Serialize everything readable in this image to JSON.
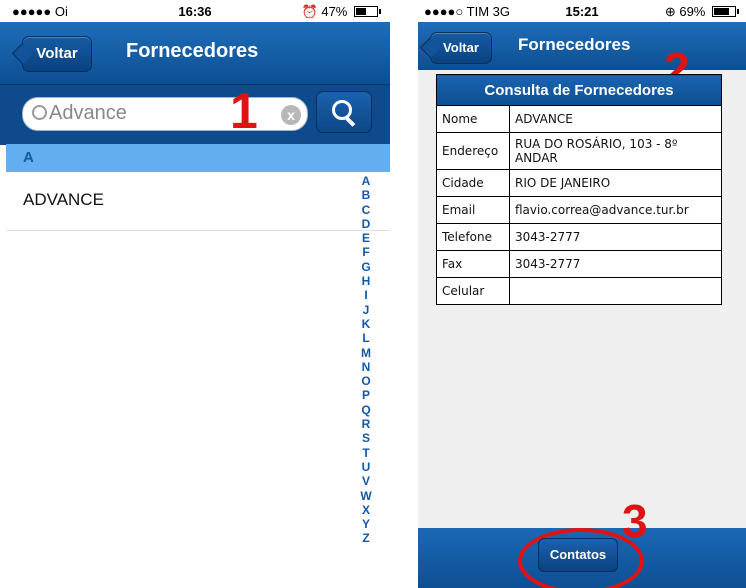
{
  "left_screen": {
    "status": {
      "carrier": "●●●●● Oi ",
      "wifi_icon": "wifi-icon",
      "time": "16:36",
      "battery_text": "47%",
      "battery_level": 0.47
    },
    "nav": {
      "back_label": "Voltar",
      "title": "Fornecedores"
    },
    "search": {
      "value": "Advance",
      "clear_glyph": "x"
    },
    "section_header": "A",
    "list": [
      {
        "label": "ADVANCE"
      }
    ],
    "index_letters": [
      "A",
      "B",
      "C",
      "D",
      "E",
      "F",
      "G",
      "H",
      "I",
      "J",
      "K",
      "L",
      "M",
      "N",
      "O",
      "P",
      "Q",
      "R",
      "S",
      "T",
      "U",
      "V",
      "W",
      "X",
      "Y",
      "Z"
    ],
    "annotation": "1"
  },
  "right_screen": {
    "status": {
      "carrier": "●●●●○ TIM  3G",
      "time": "15:21",
      "battery_text": "69%",
      "battery_level": 0.69
    },
    "nav": {
      "back_label": "Voltar",
      "title": "Fornecedores"
    },
    "annotation": "2",
    "table": {
      "title": "Consulta de Fornecedores",
      "rows": [
        {
          "key": "Nome",
          "value": "ADVANCE"
        },
        {
          "key": "Endereço",
          "value": "RUA DO ROSÁRIO, 103 - 8º ANDAR"
        },
        {
          "key": "Cidade",
          "value": "RIO DE JANEIRO"
        },
        {
          "key": "Email",
          "value": "flavio.correa@advance.tur.br"
        },
        {
          "key": "Telefone",
          "value": "3043-2777"
        },
        {
          "key": "Fax",
          "value": "3043-2777"
        },
        {
          "key": "Celular",
          "value": ""
        }
      ]
    },
    "bottom": {
      "contatos_label": "Contatos"
    },
    "bottom_annotation": "3"
  },
  "colors": {
    "nav_blue": "#1a64b0",
    "section_blue": "#63aef0",
    "annotation_red": "#e01313"
  }
}
